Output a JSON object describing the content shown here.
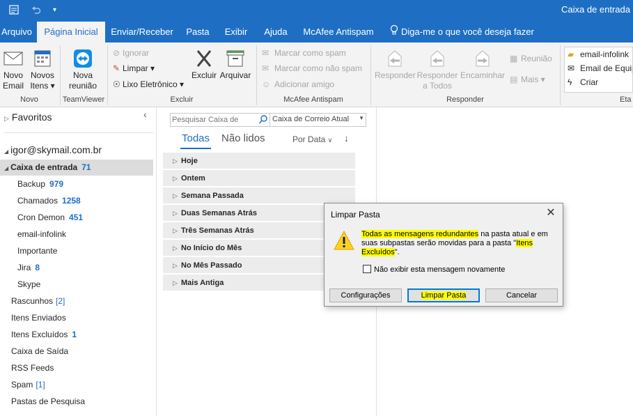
{
  "window": {
    "title": "Caixa de entrada"
  },
  "menu": {
    "tabs": [
      "Arquivo",
      "Página Inicial",
      "Enviar/Receber",
      "Pasta",
      "Exibir",
      "Ajuda",
      "McAfee Antispam"
    ],
    "tell_me": "Diga-me o que você deseja fazer"
  },
  "ribbon": {
    "novo_email": "Novo\nEmail",
    "novo_email_1": "Novo",
    "novo_email_2": "Email",
    "novos_itens_1": "Novos",
    "novos_itens_2": "Itens",
    "nova_reuniao_1": "Nova",
    "nova_reuniao_2": "reunião",
    "group_novo": "Novo",
    "group_teamviewer": "TeamViewer",
    "ignorar": "Ignorar",
    "limpar": "Limpar",
    "lixo": "Lixo Eletrônico",
    "excluir": "Excluir",
    "arquivar": "Arquivar",
    "group_excluir": "Excluir",
    "marcar_spam": "Marcar como spam",
    "marcar_nao_spam": "Marcar como não spam",
    "adicionar_amigo": "Adicionar amigo",
    "group_mcafee": "McAfee Antispam",
    "responder": "Responder",
    "responder_todos_1": "Responder",
    "responder_todos_2": "a Todos",
    "encaminhar": "Encaminhar",
    "reuniao": "Reunião",
    "mais": "Mais",
    "group_responder": "Responder",
    "quick_1": "email-infolink",
    "quick_2": "Email de Equip",
    "quick_3": "Criar",
    "group_etapas": "Eta"
  },
  "folders": {
    "favoritos": "Favoritos",
    "account": "igor@skymail.com.br",
    "items": [
      {
        "label": "Caixa de entrada",
        "count": "71"
      },
      {
        "label": "Backup",
        "count": "979"
      },
      {
        "label": "Chamados",
        "count": "1258"
      },
      {
        "label": "Cron Demon",
        "count": "451"
      },
      {
        "label": "email-infolink",
        "count": ""
      },
      {
        "label": "Importante",
        "count": ""
      },
      {
        "label": "Jira",
        "count": "8"
      },
      {
        "label": "Skype",
        "count": ""
      },
      {
        "label": "Rascunhos",
        "count": "[2]"
      },
      {
        "label": "Itens Enviados",
        "count": ""
      },
      {
        "label": "Itens Excluídos",
        "count": "1"
      },
      {
        "label": "Caixa de Saída",
        "count": ""
      },
      {
        "label": "RSS Feeds",
        "count": ""
      },
      {
        "label": "Spam",
        "count": "[1]"
      },
      {
        "label": "Pastas de Pesquisa",
        "count": ""
      }
    ]
  },
  "messages": {
    "search_placeholder": "Pesquisar Caixa de",
    "scope": "Caixa de Correio Atual",
    "filter_all": "Todas",
    "filter_unread": "Não lidos",
    "sort": "Por Data",
    "groups": [
      "Hoje",
      "Ontem",
      "Semana Passada",
      "Duas Semanas Atrás",
      "Três Semanas Atrás",
      "No Início do Mês",
      "No Mês Passado",
      "Mais Antiga"
    ]
  },
  "dialog": {
    "title": "Limpar Pasta",
    "msg_a": "Todas as mensagens redundantes",
    "msg_b": " na pasta atual e em suas subpastas serão movidas para a pasta \"",
    "msg_c": "Itens Excluídos",
    "msg_d": "\".",
    "checkbox": "Não exibir esta mensagem novamente",
    "btn_config": "Configurações",
    "btn_limpar": "Limpar Pasta",
    "btn_cancelar": "Cancelar",
    "accent": "#0078d7",
    "highlight": "#ffff00"
  }
}
